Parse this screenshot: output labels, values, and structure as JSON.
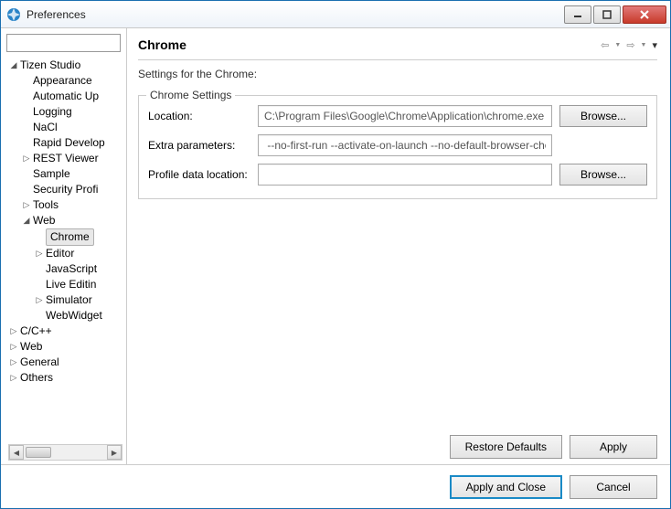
{
  "window": {
    "title": "Preferences"
  },
  "sidebar": {
    "filter": "",
    "root": {
      "label": "Tizen Studio",
      "children": [
        {
          "label": "Appearance"
        },
        {
          "label": "Automatic Up"
        },
        {
          "label": "Logging"
        },
        {
          "label": "NaCl"
        },
        {
          "label": "Rapid Develop"
        },
        {
          "label": "REST Viewer",
          "expandable": true
        },
        {
          "label": "Sample"
        },
        {
          "label": "Security Profi"
        },
        {
          "label": "Tools",
          "expandable": true
        },
        {
          "label": "Web",
          "expanded": true,
          "children": [
            {
              "label": "Chrome",
              "selected": true
            },
            {
              "label": "Editor",
              "expandable": true
            },
            {
              "label": "JavaScript"
            },
            {
              "label": "Live Editin"
            },
            {
              "label": "Simulator",
              "expandable": true
            },
            {
              "label": "WebWidget"
            }
          ]
        }
      ]
    },
    "others": [
      {
        "label": "C/C++",
        "expandable": true
      },
      {
        "label": "Web",
        "expandable": true
      },
      {
        "label": "General",
        "expandable": true
      },
      {
        "label": "Others",
        "expandable": true
      }
    ]
  },
  "main": {
    "heading": "Chrome",
    "subheading": "Settings for the Chrome:",
    "group_title": "Chrome Settings",
    "rows": {
      "location": {
        "label": "Location:",
        "value": "C:\\Program Files\\Google\\Chrome\\Application\\chrome.exe",
        "browse": "Browse..."
      },
      "extra": {
        "label": "Extra parameters:",
        "value": " --no-first-run --activate-on-launch --no-default-browser-check --allow-file-a"
      },
      "profile": {
        "label": "Profile data location:",
        "value": "",
        "browse": "Browse..."
      }
    },
    "restore": "Restore Defaults",
    "apply": "Apply"
  },
  "footer": {
    "apply_close": "Apply and Close",
    "cancel": "Cancel"
  }
}
